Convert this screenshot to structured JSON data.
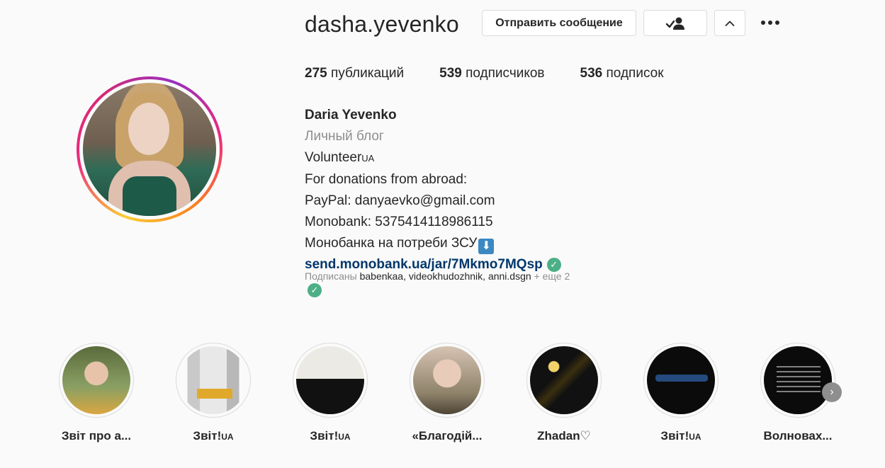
{
  "profile": {
    "username": "dasha.yevenko",
    "avatar_icon": "profile-photo",
    "buttons": {
      "message_label": "Отправить сообщение",
      "follow_icon": "user-check-icon",
      "suggest_icon": "chevron-up-icon",
      "more_icon": "more-options-icon"
    },
    "stats": [
      {
        "count": "275",
        "label": "публикаций"
      },
      {
        "count": "539",
        "label": "подписчиков"
      },
      {
        "count": "536",
        "label": "подписок"
      }
    ],
    "bio": {
      "full_name": "Daria Yevenko",
      "category": "Личный блог",
      "line1_text": "Volunteer",
      "line1_suffix": "UA",
      "line2": "For donations from abroad:",
      "line3": "PayPal: danyaevko@gmail.com",
      "line4": "Monobank: 5375414118986115",
      "line5": "Монобанка на потреби ЗСУ",
      "line5_emoji": "⬇",
      "link": "send.monobank.ua/jar/7Mkmo7MQsp",
      "check_glyph": "✓"
    },
    "followed_by": {
      "prefix": "Подписаны",
      "accounts": "babenkaa, videokhudozhnik, anni.dsgn",
      "more": "+ еще 2"
    }
  },
  "highlights": [
    {
      "label": "Звіт про а...",
      "suffix": ""
    },
    {
      "label": "Звіт!",
      "suffix": "UA"
    },
    {
      "label": "Звіт!",
      "suffix": "UA"
    },
    {
      "label": "«Благодій...",
      "suffix": ""
    },
    {
      "label": "Zhadan♡",
      "suffix": ""
    },
    {
      "label": "Звіт!",
      "suffix": "UA"
    },
    {
      "label": "Волновах...",
      "suffix": ""
    }
  ],
  "highlights_next_glyph": "›"
}
